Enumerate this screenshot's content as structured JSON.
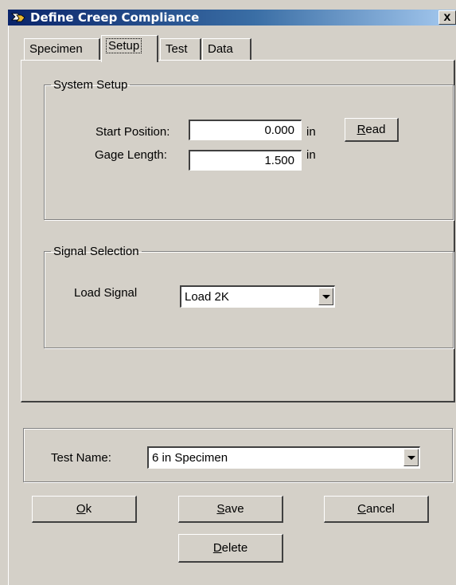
{
  "window": {
    "title": "Define Creep Compliance",
    "close_label": "x"
  },
  "tabs": [
    {
      "label": "Specimen",
      "active": false
    },
    {
      "label": "Setup",
      "active": true
    },
    {
      "label": "Test",
      "active": false
    },
    {
      "label": "Data",
      "active": false
    }
  ],
  "system_setup": {
    "title": "System Setup",
    "start_position_label": "Start Position:",
    "start_position_value": "0.000",
    "start_position_unit": "in",
    "gage_length_label": "Gage Length:",
    "gage_length_value": "1.500",
    "gage_length_unit": "in",
    "read_button": {
      "label": "Read",
      "mnemonic": "R",
      "rest": "ead"
    }
  },
  "signal_selection": {
    "title": "Signal Selection",
    "load_signal_label": "Load Signal",
    "load_signal_value": "Load 2K"
  },
  "test_name": {
    "label": "Test Name:",
    "value": "6 in Specimen"
  },
  "buttons": {
    "ok": {
      "label": "Ok",
      "mnemonic": "O",
      "rest": "k"
    },
    "save": {
      "label": "Save",
      "mnemonic": "S",
      "rest": "ave"
    },
    "cancel": {
      "label": "Cancel",
      "mnemonic": "C",
      "rest": "ancel"
    },
    "delete": {
      "label": "Delete",
      "mnemonic": "D",
      "rest": "elete"
    }
  }
}
